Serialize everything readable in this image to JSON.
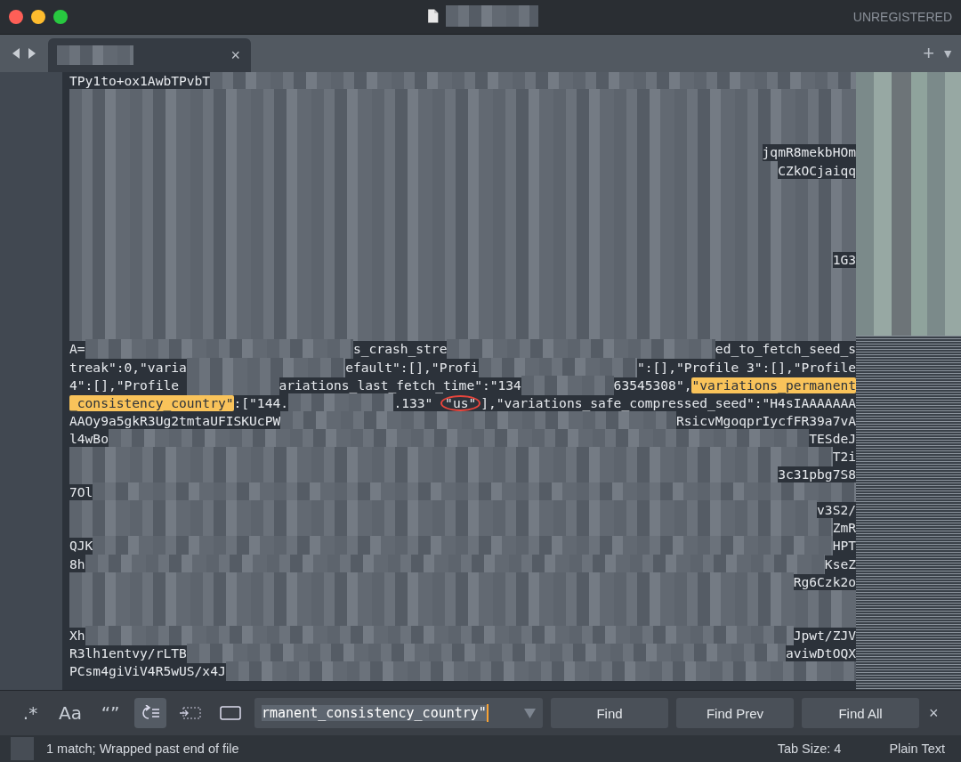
{
  "window": {
    "title_redacted": true,
    "status": "UNREGISTERED"
  },
  "tabs": [
    {
      "title_redacted": true,
      "selected": true,
      "close": "×"
    }
  ],
  "tab_bar": {
    "add": "+",
    "menu": "▼"
  },
  "editor": {
    "lines": [
      [
        {
          "kind": "text",
          "text": "TPy1to+ox1AwbTPvbT"
        },
        {
          "kind": "redacted"
        }
      ],
      [
        {
          "kind": "redacted"
        }
      ],
      [
        {
          "kind": "redacted"
        }
      ],
      [
        {
          "kind": "redacted"
        }
      ],
      [
        {
          "kind": "redacted"
        },
        {
          "kind": "text",
          "text": "jqmR8mekbHOm"
        }
      ],
      [
        {
          "kind": "redacted"
        },
        {
          "kind": "text",
          "text": "CZkOCjaiqq"
        }
      ],
      [
        {
          "kind": "redacted"
        }
      ],
      [
        {
          "kind": "redacted"
        }
      ],
      [
        {
          "kind": "redacted"
        }
      ],
      [
        {
          "kind": "redacted"
        }
      ],
      [
        {
          "kind": "redacted"
        },
        {
          "kind": "text",
          "text": "1G3"
        }
      ],
      [
        {
          "kind": "redacted"
        }
      ],
      [
        {
          "kind": "redacted"
        }
      ],
      [
        {
          "kind": "redacted"
        }
      ],
      [
        {
          "kind": "redacted"
        }
      ],
      [
        {
          "kind": "text",
          "text": "A="
        },
        {
          "kind": "redacted"
        },
        {
          "kind": "text",
          "text": "s_crash_stre"
        },
        {
          "kind": "redacted"
        },
        {
          "kind": "text",
          "text": "ed_to_fetch_seed_s"
        }
      ],
      [
        {
          "kind": "text",
          "text": "treak\":0,\"varia"
        },
        {
          "kind": "redacted"
        },
        {
          "kind": "text",
          "text": "efault\":[],\"Profi"
        },
        {
          "kind": "redacted"
        },
        {
          "kind": "text",
          "text": "\":[],\"Profile 3\":[],\"Profile"
        }
      ],
      [
        {
          "kind": "text",
          "text": "4\":[],\"Profile "
        },
        {
          "kind": "redacted"
        },
        {
          "kind": "text",
          "text": "ariations_last_fetch_time\":\"134"
        },
        {
          "kind": "redacted"
        },
        {
          "kind": "text",
          "text": "63545308\","
        },
        {
          "kind": "match",
          "text": "\"variations_permanent"
        }
      ],
      [
        {
          "kind": "match",
          "text": "_consistency_country\""
        },
        {
          "kind": "text",
          "text": ":[\"144."
        },
        {
          "kind": "redacted"
        },
        {
          "kind": "text",
          "text": ".133\" "
        },
        {
          "kind": "circled",
          "text": "\"us\""
        },
        {
          "kind": "text",
          "text": "],\"variations_safe_compressed_seed\":\"H4sIAAAAAAA"
        }
      ],
      [
        {
          "kind": "text",
          "text": "AAOy9a5gkR3Ug2tmtaUFISKUcPW"
        },
        {
          "kind": "redacted"
        },
        {
          "kind": "text",
          "text": "RsicvMgoqprIycfFR39a7vA"
        }
      ],
      [
        {
          "kind": "text",
          "text": "l4wBo"
        },
        {
          "kind": "redacted"
        },
        {
          "kind": "text",
          "text": "TESdeJ"
        }
      ],
      [
        {
          "kind": "redacted"
        },
        {
          "kind": "text",
          "text": "T2i"
        }
      ],
      [
        {
          "kind": "redacted"
        },
        {
          "kind": "text",
          "text": "3c31pbg7S8"
        }
      ],
      [
        {
          "kind": "text",
          "text": "7Ol"
        },
        {
          "kind": "redacted"
        }
      ],
      [
        {
          "kind": "redacted"
        },
        {
          "kind": "text",
          "text": "v3S2/"
        }
      ],
      [
        {
          "kind": "redacted"
        },
        {
          "kind": "text",
          "text": "ZmR"
        }
      ],
      [
        {
          "kind": "text",
          "text": "QJK"
        },
        {
          "kind": "redacted"
        },
        {
          "kind": "text",
          "text": "HPT"
        }
      ],
      [
        {
          "kind": "text",
          "text": "8h"
        },
        {
          "kind": "redacted"
        },
        {
          "kind": "text",
          "text": "KseZ"
        }
      ],
      [
        {
          "kind": "redacted"
        },
        {
          "kind": "text",
          "text": "Rg6Czk2o"
        }
      ],
      [
        {
          "kind": "redacted"
        }
      ],
      [
        {
          "kind": "redacted"
        }
      ],
      [
        {
          "kind": "text",
          "text": "Xh"
        },
        {
          "kind": "redacted"
        },
        {
          "kind": "text",
          "text": "Jpwt/ZJV"
        }
      ],
      [
        {
          "kind": "text",
          "text": "R3lh1entvy/rLTB"
        },
        {
          "kind": "redacted"
        },
        {
          "kind": "text",
          "text": "aviwDtOQX"
        }
      ],
      [
        {
          "kind": "text",
          "text": "PCsm4giViV4R5wUS/x4J"
        },
        {
          "kind": "redacted"
        }
      ]
    ]
  },
  "find_panel": {
    "options": [
      {
        "kind": "regex",
        "label": ".*",
        "selected": false
      },
      {
        "kind": "case",
        "label": "Aa",
        "selected": false
      },
      {
        "kind": "word",
        "label": "“”",
        "selected": false
      },
      {
        "kind": "wrap",
        "selected": true
      },
      {
        "kind": "selection",
        "selected": false
      },
      {
        "kind": "highlight",
        "selected": false
      }
    ],
    "value": "rmanent_consistency_country\"",
    "buttons": [
      "Find",
      "Find Prev",
      "Find All"
    ],
    "close": "×"
  },
  "status_bar": {
    "message": "1 match; Wrapped past end of file",
    "tab_size": "Tab Size: 4",
    "syntax": "Plain Text"
  }
}
